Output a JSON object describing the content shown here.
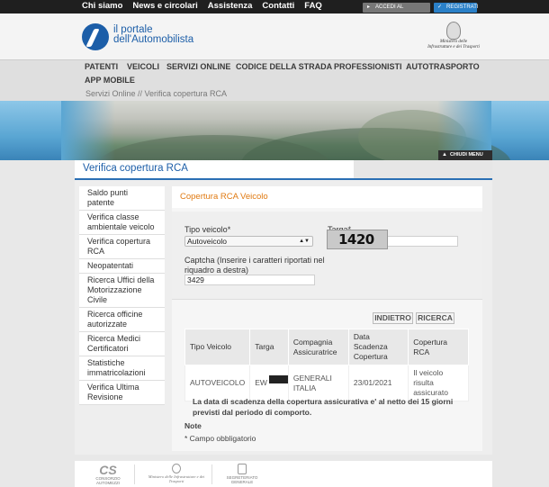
{
  "topbar": {
    "links": [
      "Chi siamo",
      "News e circolari",
      "Assistenza",
      "Contatti",
      "FAQ"
    ],
    "login_label": "ACCEDI AL PORTALE",
    "register_label": "REGISTRATI"
  },
  "header": {
    "logo_line1": "il portale",
    "logo_line2": "dell'Automobilista",
    "ministry_line1": "Ministero delle",
    "ministry_line2": "Infrastrutture e dei Trasporti"
  },
  "nav": {
    "items": [
      "PATENTI",
      "VEICOLI",
      "SERVIZI ONLINE",
      "CODICE DELLA STRADA",
      "PROFESSIONISTI",
      "AUTOTRASPORTO",
      "APP MOBILE"
    ]
  },
  "breadcrumb": "Servizi Online // Verifica copertura RCA",
  "banner": {
    "close_menu_label": "CHIUDI MENU"
  },
  "page": {
    "title": "Verifica copertura RCA"
  },
  "sidebar": {
    "items": [
      "Saldo punti patente",
      "Verifica classe ambientale veicolo",
      "Verifica copertura RCA",
      "Neopatentati",
      "Ricerca Uffici della Motorizzazione Civile",
      "Ricerca officine autorizzate",
      "Ricerca Medici Certificatori",
      "Statistiche immatricolazioni",
      "Verifica Ultima Revisione"
    ]
  },
  "form": {
    "panel_title": "Copertura RCA Veicolo",
    "tipo_veicolo_label": "Tipo veicolo*",
    "tipo_veicolo_value": "Autoveicolo",
    "targa_label": "Targa*",
    "targa_value": "EW",
    "captcha_label": "Captcha (Inserire i caratteri riportati nel riquadro a destra)",
    "captcha_value": "3429",
    "captcha_image_text": "1420",
    "back_button": "INDIETRO",
    "search_button": "RICERCA"
  },
  "results": {
    "headers": [
      "Tipo Veicolo",
      "Targa",
      "Compagnia Assicuratrice",
      "Data Scadenza Copertura",
      "Copertura RCA"
    ],
    "rows": [
      [
        "AUTOVEICOLO",
        "EW",
        "GENERALI ITALIA",
        "23/01/2021",
        "Il veicolo risulta assicurato"
      ]
    ]
  },
  "notes": {
    "disclaimer": "La data di scadenza della copertura assicurativa e' al netto dei 15 giorni previsti dal periodo di comporto.",
    "note_label": "Note",
    "required": "* Campo obbligatorio"
  },
  "footer": {
    "logo1": "CONSORZIO AUTOMEZZI",
    "logo2": "Ministero delle Infrastrutture e dei Trasporti",
    "logo3": "SEGRETERIATO GENERALE"
  },
  "colors": {
    "brand_blue": "#1c5ea8",
    "accent_orange": "#e07a12",
    "topbar": "#1f1f1f"
  }
}
